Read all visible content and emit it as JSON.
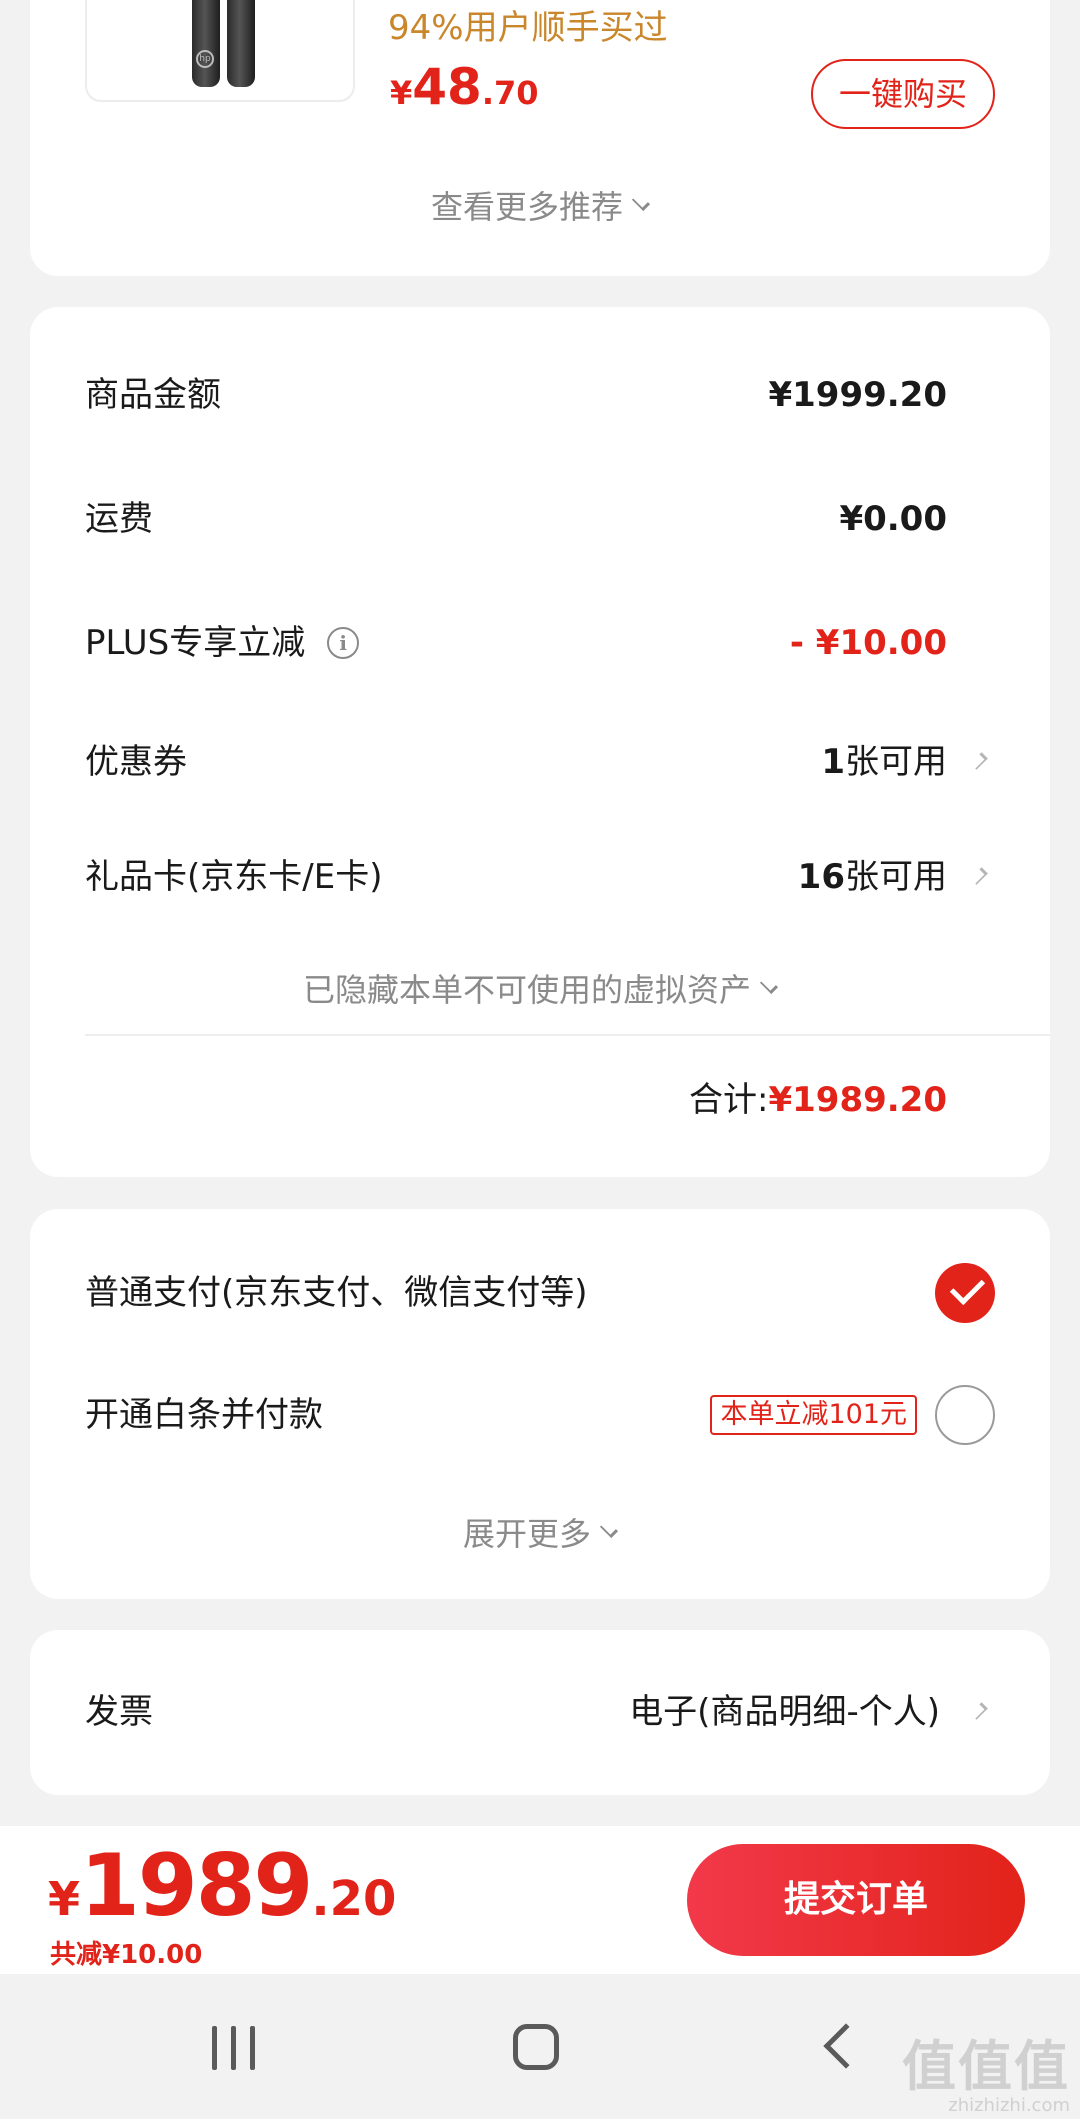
{
  "recommend": {
    "sold_text": "94%用户顺手买过",
    "price_currency": "¥",
    "price_int": "48",
    "price_dec": ".70",
    "buy_label": "一键购买",
    "more_label": "查看更多推荐"
  },
  "amount": {
    "goods_label": "商品金额",
    "goods_value": "¥1999.20",
    "shipping_label": "运费",
    "shipping_value": "¥0.00",
    "plus_label": "PLUS专享立减",
    "plus_value": "- ¥10.00",
    "coupon_label": "优惠券",
    "coupon_count": "1",
    "coupon_suffix": "张可用",
    "giftcard_label": "礼品卡(京东卡/E卡)",
    "giftcard_count": "16",
    "giftcard_suffix": "张可用",
    "hidden_assets_label": "已隐藏本单不可使用的虚拟资产",
    "total_label": "合计:",
    "total_value": "¥1989.20"
  },
  "payment": {
    "normal_label": "普通支付(京东支付、微信支付等)",
    "baitiao_label": "开通白条并付款",
    "baitiao_promo": "本单立减101元",
    "expand_label": "展开更多"
  },
  "invoice": {
    "label": "发票",
    "value": "电子(商品明细-个人)"
  },
  "bottom": {
    "currency": "¥",
    "price_int": "1989",
    "price_dec": ".20",
    "saved_text": "共减¥10.00",
    "submit_label": "提交订单"
  },
  "watermark": {
    "main": "值值值",
    "sub": "zhizhizhi.com"
  },
  "colors": {
    "accent": "#e2231a",
    "sold_text": "#c9862b",
    "background": "#f2f2f2"
  },
  "icons": [
    "info-icon",
    "chevron-right-icon",
    "chevron-down-icon",
    "check-icon",
    "recents-icon",
    "home-icon",
    "back-icon"
  ]
}
